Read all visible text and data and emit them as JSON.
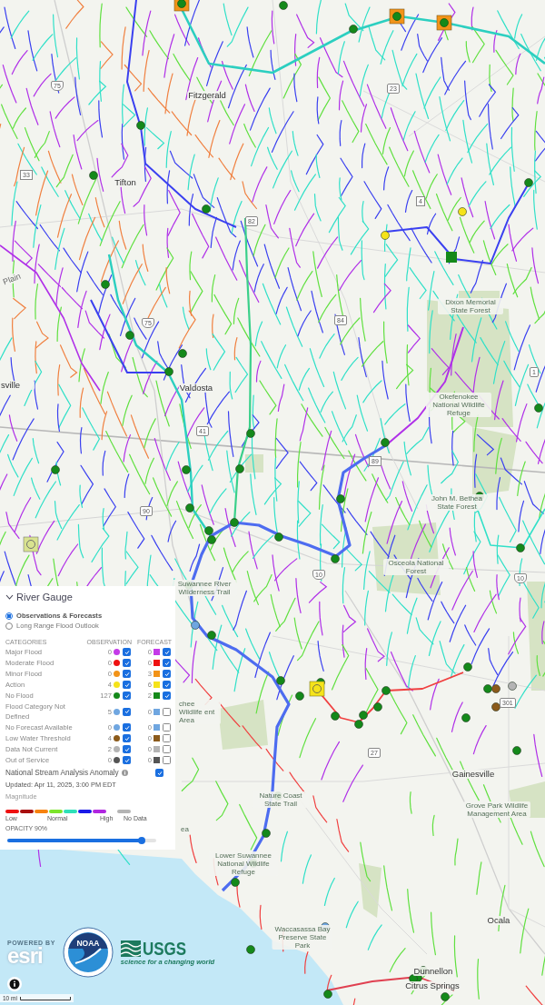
{
  "map": {
    "labels": [
      {
        "text": "Fitzgerald",
        "kind": "place"
      },
      {
        "text": "Tifton",
        "kind": "place"
      },
      {
        "text": "Valdosta",
        "kind": "place"
      },
      {
        "text": "sville",
        "kind": "place"
      },
      {
        "text": "Plain",
        "kind": "slanted"
      },
      {
        "text": "Dixon Memorial State Forest",
        "kind": "area"
      },
      {
        "text": "Okefenokee National Wildlife Refuge",
        "kind": "area"
      },
      {
        "text": "John M. Bethea State Forest",
        "kind": "area"
      },
      {
        "text": "Osceola National Forest",
        "kind": "area"
      },
      {
        "text": "Suwannee River Wilderness Trail",
        "kind": "area"
      },
      {
        "text": "chee Wildlife ent Area",
        "kind": "area"
      },
      {
        "text": "Gainesville",
        "kind": "place"
      },
      {
        "text": "Grove Park Wildlife Management Area",
        "kind": "area"
      },
      {
        "text": "Nature Coast State Trail",
        "kind": "area"
      },
      {
        "text": "Lower Suwannee National Wildlife Refuge",
        "kind": "area"
      },
      {
        "text": "Waccasassa Bay Preserve State Park",
        "kind": "area"
      },
      {
        "text": "Ocala",
        "kind": "place"
      },
      {
        "text": "Dunnellon",
        "kind": "place"
      },
      {
        "text": "Citrus Springs",
        "kind": "place"
      },
      {
        "text": "ea",
        "kind": "area"
      }
    ],
    "shields": [
      {
        "text": "75",
        "kind": "interstate"
      },
      {
        "text": "23",
        "kind": "us"
      },
      {
        "text": "4",
        "kind": "state"
      },
      {
        "text": "33",
        "kind": "state"
      },
      {
        "text": "82",
        "kind": "us"
      },
      {
        "text": "75",
        "kind": "interstate"
      },
      {
        "text": "84",
        "kind": "us"
      },
      {
        "text": "41",
        "kind": "us"
      },
      {
        "text": "90",
        "kind": "us"
      },
      {
        "text": "89",
        "kind": "state"
      },
      {
        "text": "10",
        "kind": "interstate"
      },
      {
        "text": "10",
        "kind": "interstate"
      },
      {
        "text": "1",
        "kind": "us"
      },
      {
        "text": "27",
        "kind": "us"
      },
      {
        "text": "301",
        "kind": "us"
      }
    ]
  },
  "legend": {
    "title": "River Gauge",
    "expanded": true,
    "modes": [
      {
        "label": "Observations & Forecasts",
        "selected": true
      },
      {
        "label": "Long Range Flood Outlook",
        "selected": false
      }
    ],
    "columns": [
      "CATEGORIES",
      "OBSERVATION",
      "FORECAST"
    ],
    "rows": [
      {
        "name": "Major Flood",
        "color": "#c43ae8",
        "observation": "0",
        "observation_on": true,
        "forecast": "0",
        "forecast_on": true
      },
      {
        "name": "Moderate Flood",
        "color": "#ee1111",
        "observation": "0",
        "observation_on": true,
        "forecast": "0",
        "forecast_on": true
      },
      {
        "name": "Minor Flood",
        "color": "#f29318",
        "observation": "0",
        "observation_on": true,
        "forecast": "3",
        "forecast_on": true
      },
      {
        "name": "Action",
        "color": "#f5e31a",
        "observation": "4",
        "observation_on": true,
        "forecast": "6",
        "forecast_on": true
      },
      {
        "name": "No Flood",
        "color": "#14891a",
        "observation": "127",
        "observation_on": true,
        "forecast": "2",
        "forecast_on": true
      },
      {
        "name": "Flood Category Not Defined",
        "color": "#6fa6e0",
        "observation": "5",
        "observation_on": true,
        "forecast": "0",
        "forecast_on": false
      },
      {
        "name": "No Forecast Available",
        "color": "#6fa6e0",
        "observation": "0",
        "observation_on": true,
        "forecast": "0",
        "forecast_on": false
      },
      {
        "name": "Low Water Threshold",
        "color": "#8b5a1b",
        "observation": "4",
        "observation_on": true,
        "forecast": "0",
        "forecast_on": false
      },
      {
        "name": "Data Not Current",
        "color": "#b4b4b4",
        "observation": "2",
        "observation_on": true,
        "forecast": "0",
        "forecast_on": false
      },
      {
        "name": "Out of Service",
        "color": "#555555",
        "observation": "0",
        "observation_on": true,
        "forecast": "0",
        "forecast_on": false
      }
    ],
    "anomaly": {
      "title": "National Stream Analysis Anomaly",
      "checked": true,
      "updated": "Updated: Apr 11, 2025, 3:00 PM EDT",
      "magnitude": "Magnitude",
      "scale": [
        {
          "kind": "band",
          "color": "#ee1111"
        },
        {
          "kind": "band",
          "color": "#a80f0f"
        },
        {
          "kind": "band",
          "color": "#f7820f"
        },
        {
          "kind": "band",
          "color": "#7ce52a"
        },
        {
          "kind": "band",
          "color": "#2ee0b8"
        },
        {
          "kind": "band",
          "color": "#1a1ae8"
        },
        {
          "kind": "band",
          "color": "#b026e0"
        },
        {
          "kind": "no_data",
          "color": "#b4b4b4"
        }
      ],
      "scale_labels": [
        "Low",
        "Normal",
        "High",
        "No Data"
      ],
      "opacity_label": "OPACITY 90%",
      "opacity": {
        "level": 0.9
      }
    }
  },
  "credits": {
    "esri_small": "POWERED BY",
    "esri": "esri",
    "noaa": "NOAA",
    "usgs": "USGS",
    "usgs_tagline": "science for a changing world",
    "scale": "10 mi"
  }
}
